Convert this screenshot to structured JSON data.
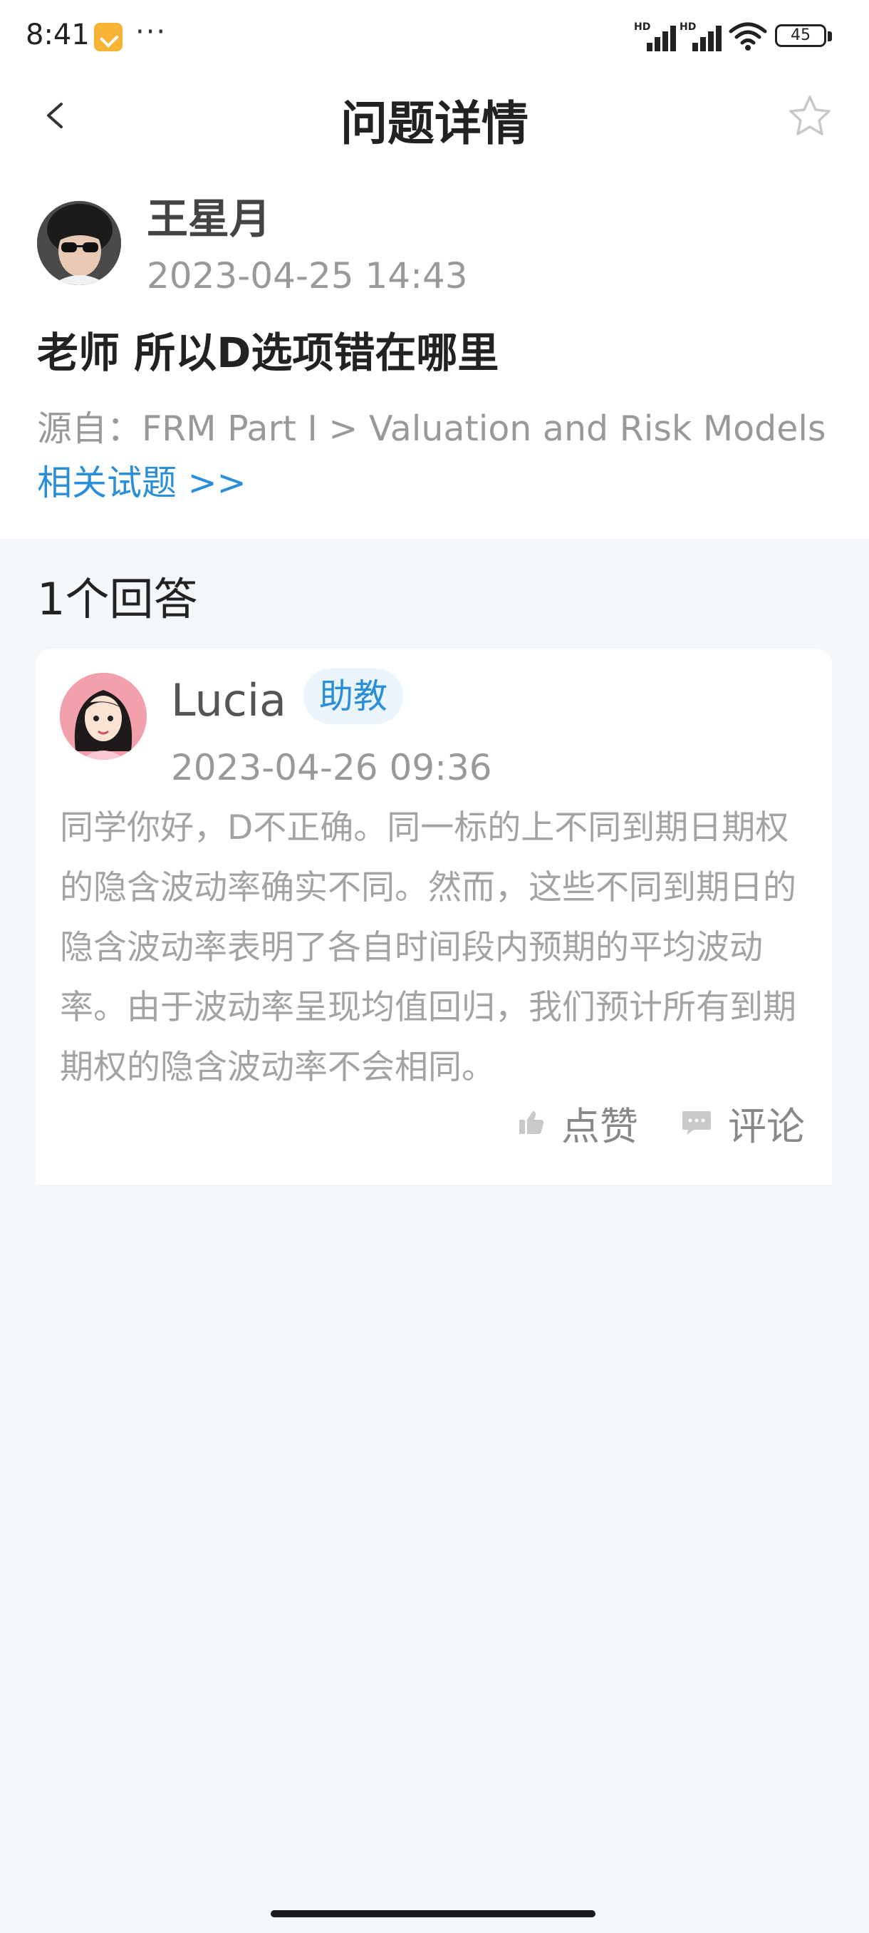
{
  "status_bar": {
    "time": "8:41",
    "dots": "···",
    "hd_label": "HD",
    "battery": "45",
    "icons": [
      "notes-icon",
      "signal-icon",
      "wifi-icon",
      "battery-icon"
    ]
  },
  "header": {
    "title": "问题详情",
    "back_icon": "back-icon",
    "favorite_icon": "star-icon"
  },
  "question": {
    "asker_name": "王星月",
    "asker_time": "2023-04-25 14:43",
    "text": "老师 所以D选项错在哪里",
    "source": "源自：FRM Part I > Valuation and Risk Models",
    "related_link": "相关试题  >>"
  },
  "answers": {
    "count_label": "1个回答",
    "items": [
      {
        "name": "Lucia",
        "role": "助教",
        "time": "2023-04-26 09:36",
        "text": "同学你好，D不正确。同一标的上不同到期日期权的隐含波动率确实不同。然而，这些不同到期日的隐含波动率表明了各自时间段内预期的平均波动率。由于波动率呈现均值回归，我们预计所有到期期权的隐含波动率不会相同。",
        "like_label": "点赞",
        "comment_label": "评论"
      }
    ]
  },
  "colors": {
    "accent": "#2a8fd8",
    "background": "#f4f7fa",
    "muted_text": "#999999"
  }
}
